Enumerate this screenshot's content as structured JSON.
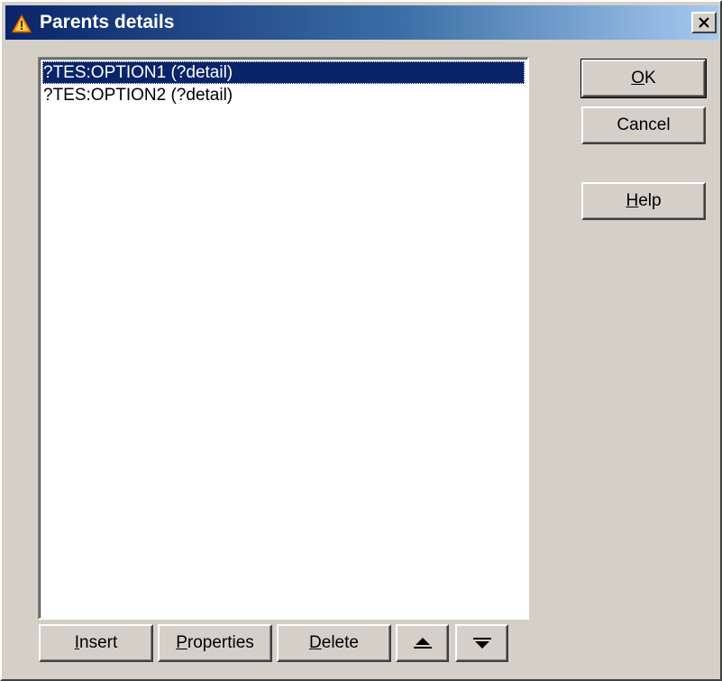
{
  "window": {
    "title": "Parents details",
    "close_label": "×",
    "app_icon": "warning-triangle-icon"
  },
  "list": {
    "items": [
      {
        "label": "?TES:OPTION1 (?detail)",
        "selected": true
      },
      {
        "label": "?TES:OPTION2 (?detail)",
        "selected": false
      }
    ]
  },
  "buttons": {
    "ok": {
      "mnemonic": "O",
      "rest": "K"
    },
    "cancel": {
      "label": "Cancel"
    },
    "help": {
      "mnemonic": "H",
      "rest": "elp"
    },
    "insert": {
      "mnemonic": "I",
      "rest": "nsert"
    },
    "properties": {
      "mnemonic": "P",
      "rest": "roperties"
    },
    "delete": {
      "mnemonic": "D",
      "rest": "elete"
    },
    "move_up_icon": "arrow-up-icon",
    "move_down_icon": "arrow-down-icon"
  },
  "colors": {
    "selection": "#0a246a",
    "face": "#d4d0c8",
    "title_gradient_start": "#0a246a",
    "title_gradient_end": "#a6caf0"
  }
}
